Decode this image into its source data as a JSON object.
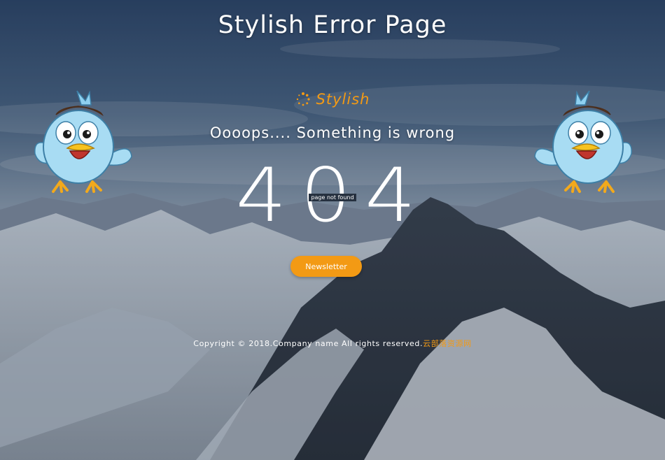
{
  "page": {
    "title": "Stylish Error Page",
    "logo_text": "Stylish",
    "message": "Oooops.... Something is wrong",
    "error_code": "404",
    "not_found_label": "page not found",
    "button_label": "Newsletter",
    "footer_text": "Copyright © 2018.Company name All rights reserved.",
    "footer_link": "云部落资源网"
  },
  "colors": {
    "accent": "#f39a14",
    "sky_top": "#2f4a70",
    "text": "#ffffff"
  },
  "icons": {
    "logo": "loading-dots-icon",
    "left_mascot": "bird-mascot-icon",
    "right_mascot": "bird-mascot-icon"
  }
}
